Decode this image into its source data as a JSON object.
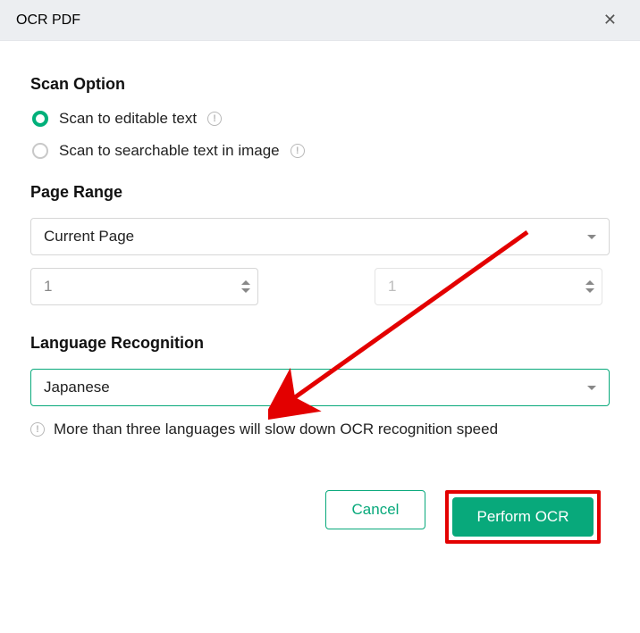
{
  "titlebar": {
    "title": "OCR PDF"
  },
  "scan_option": {
    "title": "Scan Option",
    "radios": [
      {
        "label": "Scan to editable text",
        "selected": true
      },
      {
        "label": "Scan to searchable text in image",
        "selected": false
      }
    ]
  },
  "page_range": {
    "title": "Page Range",
    "selected": "Current Page",
    "from": "1",
    "to": "1"
  },
  "language": {
    "title": "Language Recognition",
    "selected": "Japanese",
    "warning": "More than three languages will slow down OCR recognition speed"
  },
  "buttons": {
    "cancel": "Cancel",
    "perform": "Perform OCR"
  }
}
